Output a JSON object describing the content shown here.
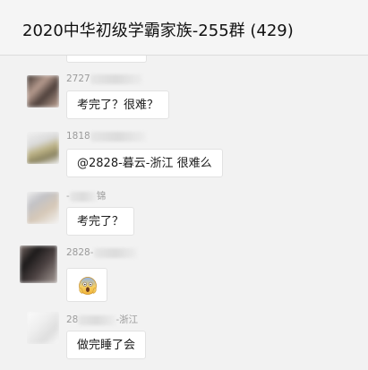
{
  "window": {
    "title": "2020中华初级学霸家族-255群 (429)"
  },
  "messages": [
    {
      "sender_visible": "2727",
      "sender_suffix": "",
      "text": "考完了？很难？"
    },
    {
      "sender_visible": "1818",
      "sender_suffix": "",
      "text": "@2828-暮云-浙江 很难么"
    },
    {
      "sender_visible": "-",
      "sender_suffix": "锦",
      "text": "考完了？"
    },
    {
      "sender_visible": "2828-",
      "sender_suffix": "",
      "emoji": "scream-emoji"
    },
    {
      "sender_visible": "28",
      "sender_suffix": "-浙江",
      "text": "做完睡了会"
    }
  ]
}
